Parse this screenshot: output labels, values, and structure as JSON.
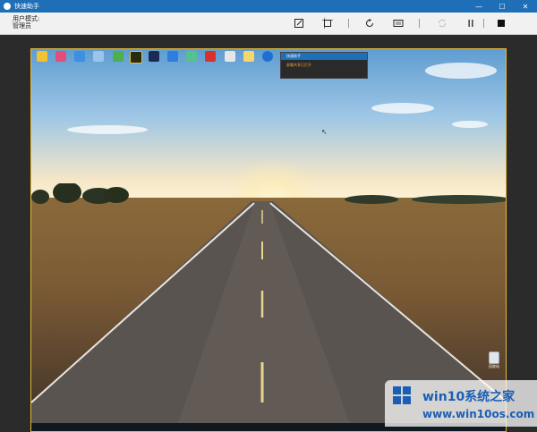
{
  "window": {
    "title": "快速助手",
    "controls": {
      "minimize": "—",
      "maximize": "☐",
      "close": "✕"
    }
  },
  "toolbar": {
    "mode_label": "用户模式:",
    "mode_value": "管理员",
    "tools": [
      {
        "icon": "edit-icon"
      },
      {
        "icon": "fit-screen-icon"
      },
      {
        "icon": "refresh-icon"
      },
      {
        "icon": "keyboard-icon"
      },
      {
        "icon": "sync-icon"
      },
      {
        "icon": "pause-icon"
      },
      {
        "icon": "stop-icon"
      }
    ]
  },
  "remote": {
    "mini_window": {
      "title": "快速助手",
      "status": "屏幕共享已打开"
    },
    "recycle_bin": "回收站"
  },
  "watermark": {
    "title": "win10系统之家",
    "url": "www.win10os.com"
  }
}
